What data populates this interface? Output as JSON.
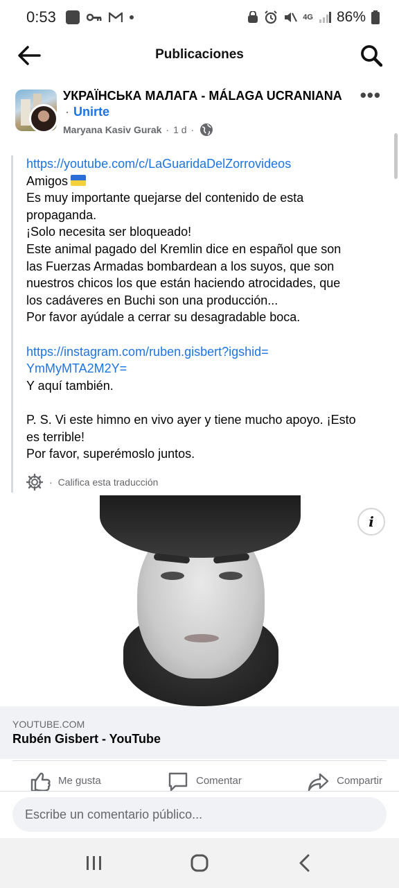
{
  "status_bar": {
    "time": "0:53",
    "network": "4G",
    "battery": "86%"
  },
  "header": {
    "title": "Publicaciones"
  },
  "post": {
    "group_name": "УКРАЇНСЬКА МАЛАГА - MÁLAGA UCRANIANA",
    "join_label": "Unirte",
    "author": "Maryana Kasiv Gurak",
    "time": "1 d",
    "body": {
      "link1": "https://youtube.com/c/LaGuaridaDelZorrovideos",
      "line1": "Amigos",
      "line2": "Es muy importante quejarse del contenido de esta",
      "line3": "propaganda.",
      "line4": "¡Solo necesita ser bloqueado!",
      "line5": "Este animal pagado del Kremlin dice en español que son",
      "line6": "las Fuerzas Armadas bombardean a los suyos, que son",
      "line7": "nuestros chicos los que están haciendo atrocidades, que",
      "line8": "los cadáveres en Buchi son una producción...",
      "line9": "Por favor ayúdale a cerrar su desagradable boca.",
      "link2a": "https://instagram.com/ruben.gisbert?igshid=",
      "link2b": "YmMyMTA2M2Y=",
      "line10": "Y aquí también.",
      "line11": "P. S. Vi este himno en vivo ayer y tiene mucho apoyo. ¡Esto",
      "line12": "es terrible!",
      "line13": "Por favor, superémoslo juntos."
    },
    "translation_label": "Califica esta traducción",
    "link_preview": {
      "domain": "YOUTUBE.COM",
      "title": "Rubén Gisbert - YouTube"
    },
    "actions": {
      "like": "Me gusta",
      "comment": "Comentar",
      "share": "Compartir"
    }
  },
  "comment_box": {
    "placeholder": "Escribe un comentario público..."
  },
  "icons": {
    "back": "arrow-left-icon",
    "search": "search-icon",
    "more": "more-horizontal-icon",
    "globe": "globe-icon",
    "flag": "ukraine-flag-icon",
    "gear": "gear-icon",
    "info": "info-icon"
  },
  "colors": {
    "link": "#1b74e4",
    "secondary_text": "#65676b",
    "preview_bg": "#f0f2f5"
  }
}
